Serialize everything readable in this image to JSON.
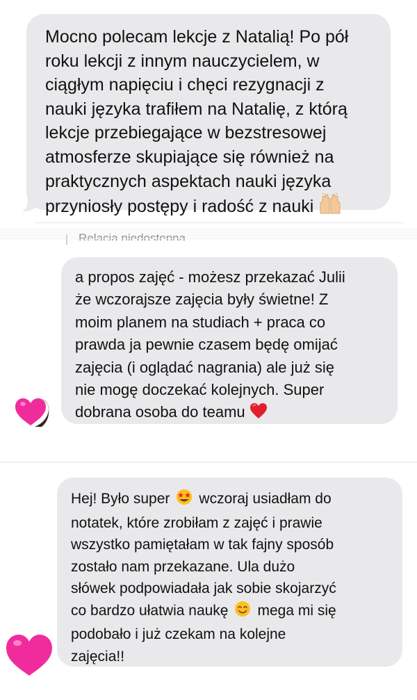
{
  "messages": [
    {
      "lines": [
        "Mocno polecam lekcje z Natalią! Po pół",
        "roku lekcji z innym nauczycielem, w",
        "ciągłym napięciu i chęci rezygnacji z",
        "nauki języka trafiłem na Natalię, z którą",
        "lekcje przebiegające w bezstresowej",
        "atmosferze skupiające się również na",
        "praktycznych aspektach nauki języka",
        "przyniosły postępy i radość z nauki"
      ],
      "emoji": "raising-hands"
    },
    {
      "status": "Relacja niedostępna",
      "lines": [
        "a propos zajęć - możesz przekazać Julii",
        "że wczorajsze zajęcia były świetne! Z",
        "moim planem na studiach + praca co",
        "prawda ja pewnie czasem będę omijać",
        "zajęcia (i oglądać nagrania) ale już się",
        "nie mogę doczekać kolejnych. Super",
        "dobrana osoba do teamu"
      ],
      "emoji": "red-heart",
      "avatar": "pink-heart-avatar"
    },
    {
      "segments": {
        "l1a": "Hej! Było super",
        "l1b": "wczoraj usiadłam do",
        "l2": "notatek, które zrobiłam z zajęć i prawie",
        "l3": "wszystko pamiętałam w tak fajny sposób",
        "l4": "zostało nam przekazane. Ula dużo",
        "l5": "słówek podpowiadała jak sobie skojarzyć",
        "l6a": "co bardzo ułatwia naukę",
        "l7": "mega mi się",
        "l8": "podobało i już czekam na kolejne",
        "l9": "zajęcia!!"
      },
      "emojis": [
        "star-struck-face",
        "smiling-face"
      ],
      "avatar": "pink-heart-avatar"
    }
  ],
  "colors": {
    "bubble": "#e9e9eb",
    "text": "#111111",
    "heart_pink": "#f02c9c",
    "heart_red": "#e0202e"
  }
}
